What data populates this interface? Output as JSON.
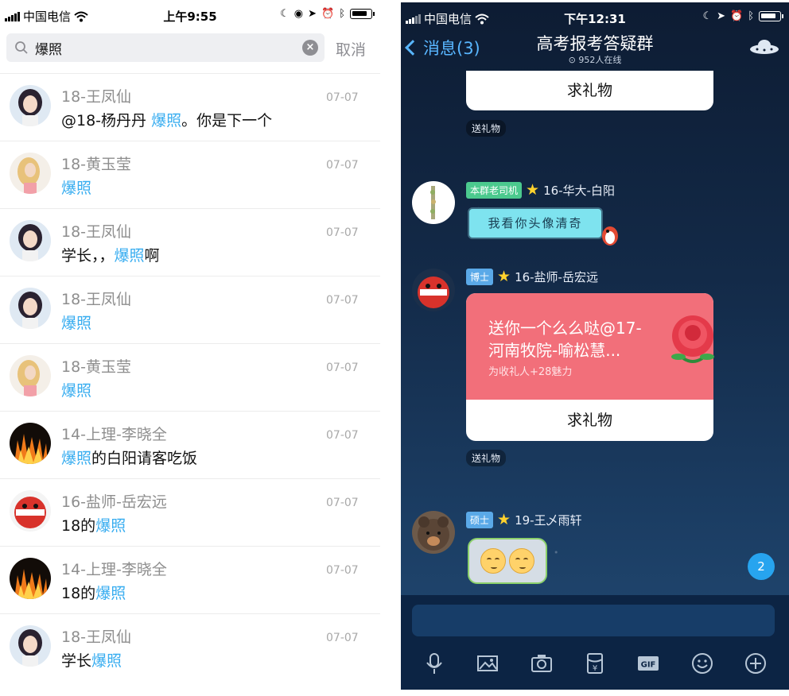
{
  "left": {
    "status": {
      "carrier": "中国电信",
      "time": "上午9:55"
    },
    "search": {
      "value": "爆照",
      "cancel": "取消"
    },
    "results": [
      {
        "name": "18-王凤仙",
        "date": "07-07",
        "pre": "@18-杨丹丹 ",
        "hl": "爆照",
        "post": "。你是下一个",
        "avatar": "girl"
      },
      {
        "name": "18-黄玉莹",
        "date": "07-07",
        "pre": "",
        "hl": "爆照",
        "post": "",
        "avatar": "blonde"
      },
      {
        "name": "18-王凤仙",
        "date": "07-07",
        "pre": "学长，，",
        "hl": "爆照",
        "post": "啊",
        "avatar": "girl"
      },
      {
        "name": "18-王凤仙",
        "date": "07-07",
        "pre": "",
        "hl": "爆照",
        "post": "",
        "avatar": "girl"
      },
      {
        "name": "18-黄玉莹",
        "date": "07-07",
        "pre": "",
        "hl": "爆照",
        "post": "",
        "avatar": "blonde"
      },
      {
        "name": "14-上理-李晓全",
        "date": "07-07",
        "pre": "",
        "hl": "爆照",
        "post": "的白阳请客吃饭",
        "avatar": "fire"
      },
      {
        "name": "16-盐师-岳宏远",
        "date": "07-07",
        "pre": "18的",
        "hl": "爆照",
        "post": "",
        "avatar": "red"
      },
      {
        "name": "14-上理-李晓全",
        "date": "07-07",
        "pre": "18的",
        "hl": "爆照",
        "post": "",
        "avatar": "fire"
      },
      {
        "name": "18-王凤仙",
        "date": "07-07",
        "pre": "学长",
        "hl": "爆照",
        "post": "",
        "avatar": "girl"
      }
    ]
  },
  "right": {
    "status": {
      "carrier": "中国电信",
      "time": "下午12:31"
    },
    "header": {
      "back": "消息(3)",
      "title": "高考报考答疑群",
      "online": "952人在线"
    },
    "gift_btn": "求礼物",
    "gift_tag": "送礼物",
    "msg1": {
      "badge": "本群老司机",
      "sender": "16-华大-白阳",
      "text": "我看你头像清奇"
    },
    "msg2": {
      "badge": "博士",
      "sender": "16-盐师-岳宏远",
      "gift_line": "送你一个么么哒@17-河南牧院-喻松慧...",
      "gift_sub": "为收礼人+28魅力"
    },
    "msg3": {
      "badge": "硕士",
      "sender": "19-王乄雨轩"
    },
    "unread": "2",
    "toolbar": {
      "gif": "GIF"
    }
  },
  "colors": {
    "highlight": "#38adf0",
    "badge_green": "#4bc98e",
    "badge_blue": "#5aa9e8",
    "gift_red": "#f26f7a"
  }
}
